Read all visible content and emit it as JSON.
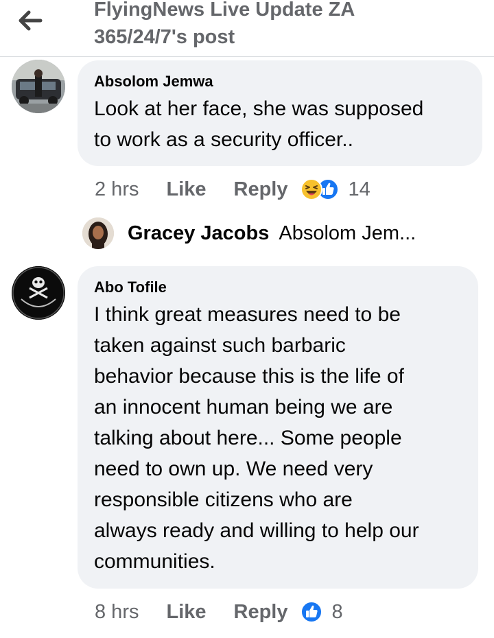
{
  "header": {
    "title_line1": "FlyingNews Live Update ZA",
    "title_line2": "365/24/7's post",
    "back_icon": "arrow-left-icon"
  },
  "comments": [
    {
      "author": "Absolom Jemwa",
      "text_lines": [
        "Look at her face, she was supposed",
        "to work as a security officer.."
      ],
      "time": "2 hrs",
      "like_label": "Like",
      "reply_label": "Reply",
      "reaction_icons": [
        "haha-reaction-icon",
        "like-reaction-icon"
      ],
      "reaction_count": "14",
      "reply_preview": {
        "author": "Gracey Jacobs",
        "text": "Absolom Jem..."
      }
    },
    {
      "author": "Abo Tofile",
      "text_lines": [
        "I think great measures need to be",
        "taken against such barbaric",
        "behavior because this is the life of",
        "an innocent human being we are",
        "talking about here... Some people",
        "need to own up. We need very",
        "responsible citizens who are",
        "always ready and willing to help our",
        "communities."
      ],
      "time": "8 hrs",
      "like_label": "Like",
      "reply_label": "Reply",
      "reaction_icons": [
        "like-reaction-icon"
      ],
      "reaction_count": "8"
    }
  ],
  "colors": {
    "bubble": "#f0f2f5",
    "secondary_text": "#65676b",
    "like_blue": "#1877f2",
    "haha_yellow": "#f7c12e"
  }
}
